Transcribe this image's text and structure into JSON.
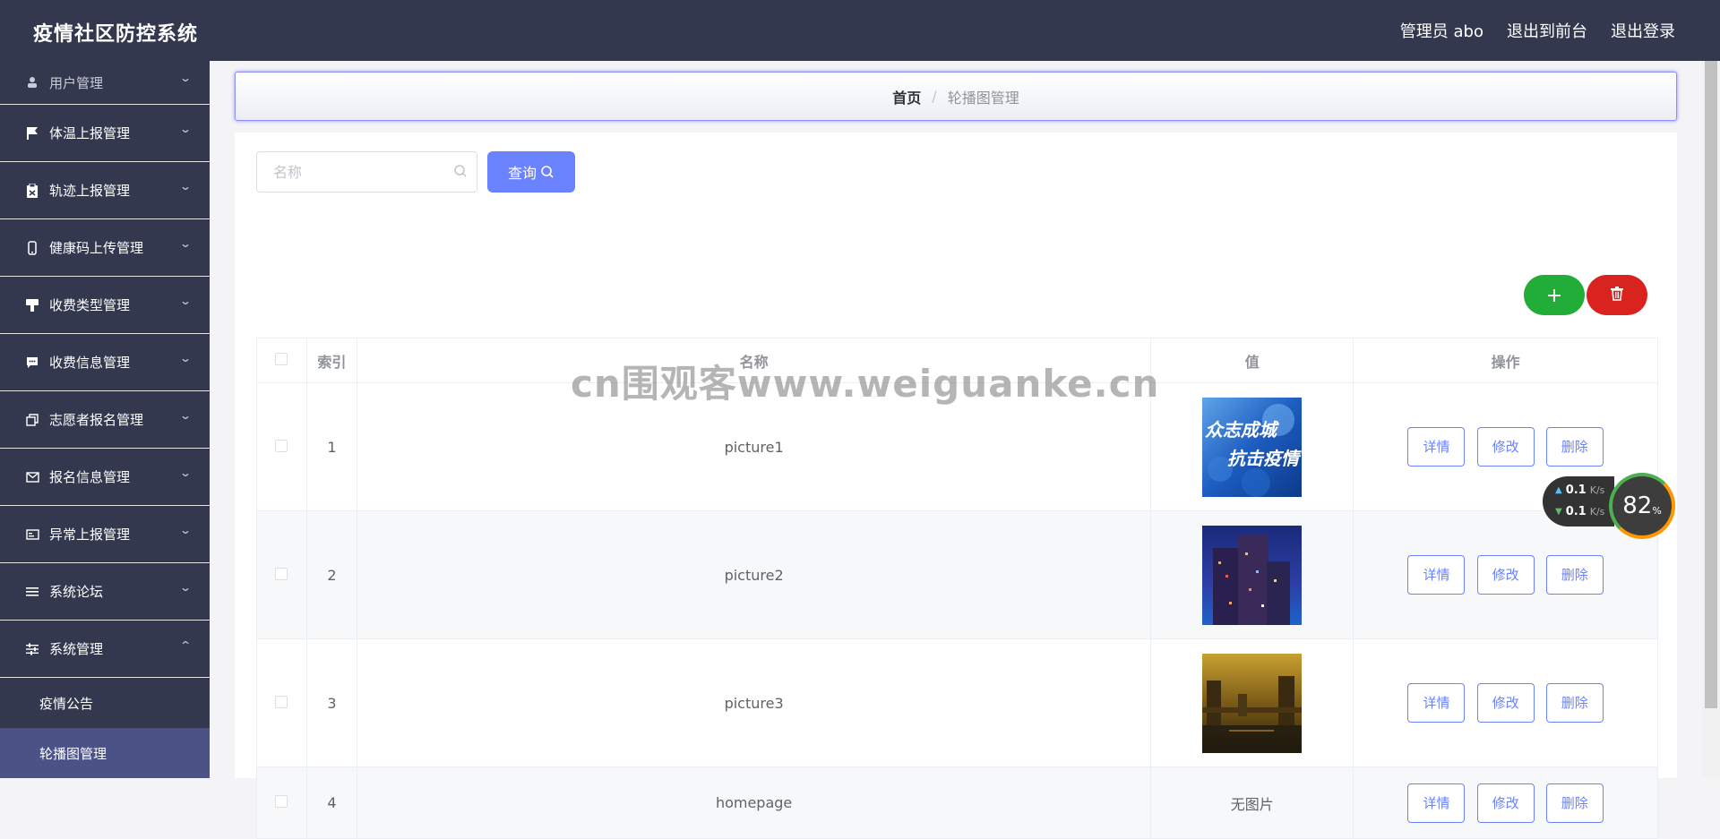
{
  "app": {
    "title": "疫情社区防控系统",
    "admin_label": "管理员 abo",
    "to_frontend": "退出到前台",
    "logout": "退出登录"
  },
  "sidebar": {
    "items": [
      {
        "label": "用户管理",
        "icon": "user-icon"
      },
      {
        "label": "体温上报管理",
        "icon": "flag-icon"
      },
      {
        "label": "轨迹上报管理",
        "icon": "clipboard-icon"
      },
      {
        "label": "健康码上传管理",
        "icon": "phone-icon"
      },
      {
        "label": "收费类型管理",
        "icon": "brush-icon"
      },
      {
        "label": "收费信息管理",
        "icon": "chat-icon"
      },
      {
        "label": "志愿者报名管理",
        "icon": "copy-icon"
      },
      {
        "label": "报名信息管理",
        "icon": "message-icon"
      },
      {
        "label": "异常上报管理",
        "icon": "postcard-icon"
      },
      {
        "label": "系统论坛",
        "icon": "list-icon"
      },
      {
        "label": "系统管理",
        "icon": "sliders-icon"
      }
    ],
    "sub_items": [
      {
        "label": "疫情公告"
      },
      {
        "label": "轮播图管理"
      }
    ]
  },
  "breadcrumb": {
    "home": "首页",
    "separator": "/",
    "current": "轮播图管理"
  },
  "search": {
    "placeholder": "名称",
    "query_label": "查询"
  },
  "table": {
    "headers": {
      "index": "索引",
      "name": "名称",
      "value": "值",
      "actions": "操作"
    },
    "rows": [
      {
        "index": "1",
        "name": "picture1",
        "image": "banner-blue-slogan"
      },
      {
        "index": "2",
        "name": "picture2",
        "image": "banner-night-city"
      },
      {
        "index": "3",
        "name": "picture3",
        "image": "banner-golden-bridge"
      },
      {
        "index": "4",
        "name": "homepage",
        "no_image_text": "无图片"
      }
    ],
    "actions": {
      "detail": "详情",
      "edit": "修改",
      "delete": "删除"
    }
  },
  "overlay": {
    "watermark": "cn围观客www.weiguanke.cn",
    "upload_speed": "0.1",
    "download_speed": "0.1",
    "speed_unit": "K/s",
    "gauge": "82",
    "gauge_unit": "%"
  },
  "colors": {
    "nav_bg": "#33384f",
    "primary": "#6b82ff",
    "add_green": "#22ac38",
    "delete_red": "#d8231e"
  }
}
